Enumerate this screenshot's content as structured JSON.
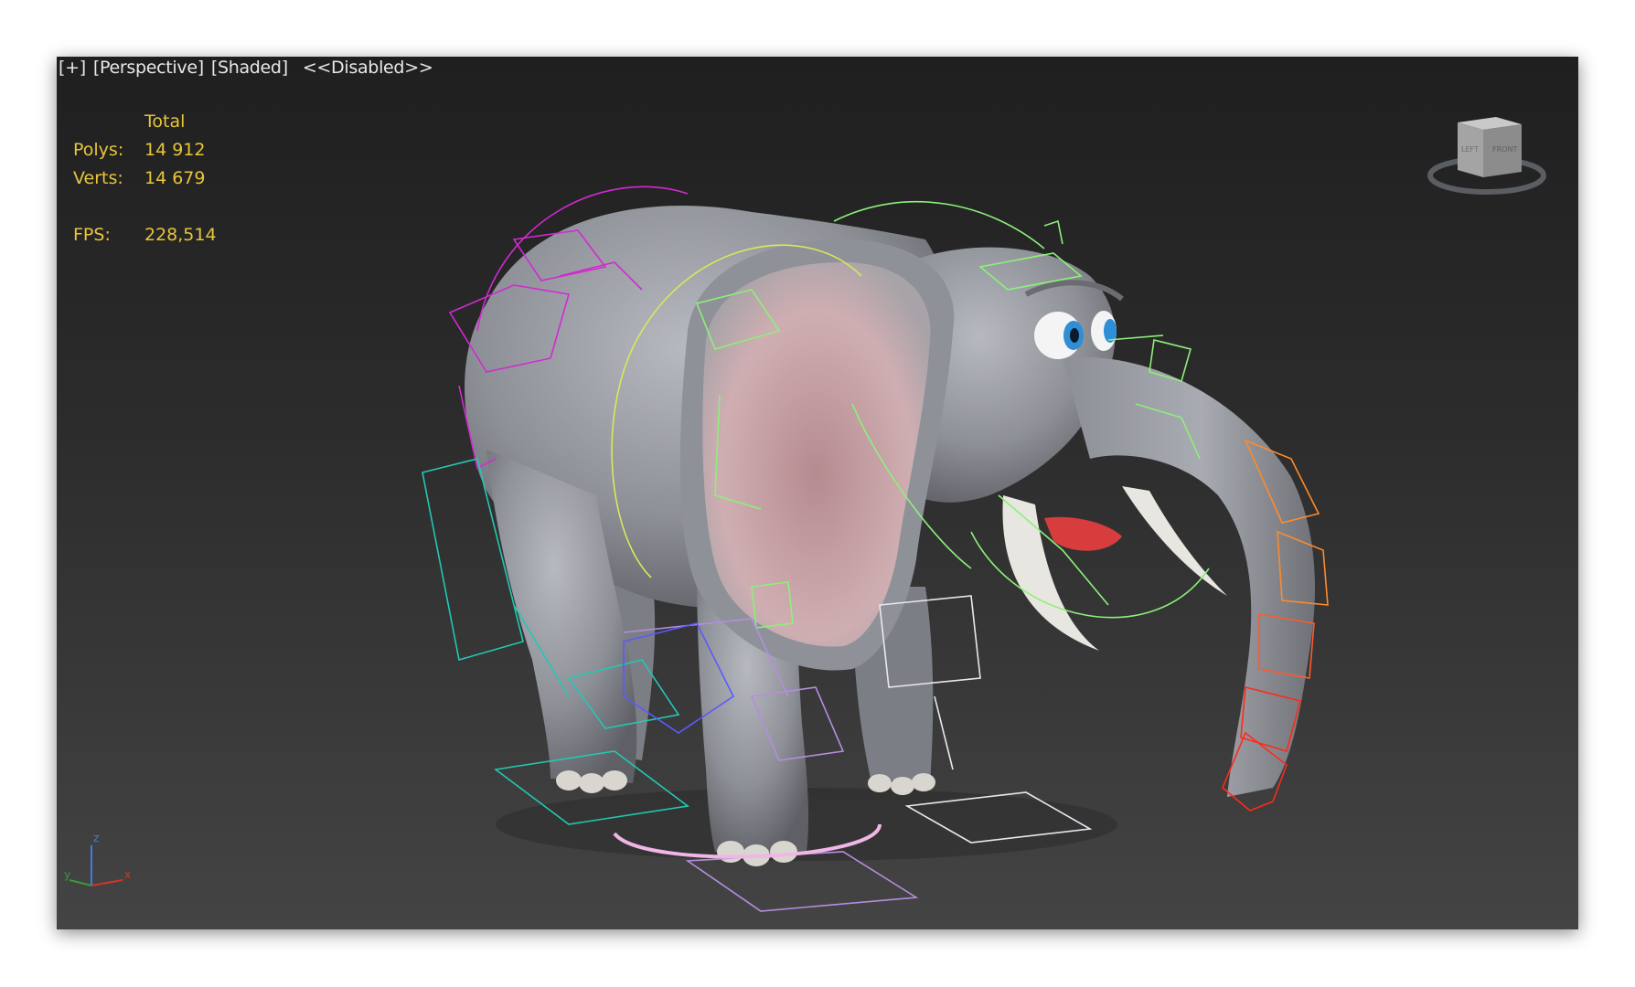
{
  "viewport": {
    "labels": {
      "menu": "[+]",
      "view": "[Perspective]",
      "shading": "[Shaded]",
      "status": "<<Disabled>>"
    },
    "stats": {
      "header": "Total",
      "polys_label": "Polys:",
      "polys_value": "14 912",
      "verts_label": "Verts:",
      "verts_value": "14 679",
      "fps_label": "FPS:",
      "fps_value": "228,514"
    },
    "viewcube": {
      "left_label": "LEFT",
      "front_label": "FRONT"
    },
    "axis_tripod": {
      "x": "x",
      "y": "y",
      "z": "z"
    }
  },
  "colors": {
    "stats_text": "#e8c53a",
    "label_text": "#e8e8e8",
    "elephant_body": "#9a9ca3",
    "ear_inner": "#c9a1a6",
    "rig_magenta": "#d22ad2",
    "rig_green": "#8cf07a",
    "rig_yellow": "#d8e85a",
    "rig_cyan": "#22c8b4",
    "rig_violet": "#b58de0",
    "rig_red": "#ff2a1a",
    "rig_orange": "#ff8a2a",
    "rig_white": "#e8e8f0"
  }
}
